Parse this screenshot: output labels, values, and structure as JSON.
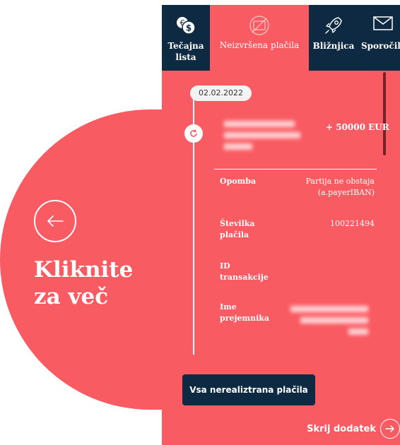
{
  "callout": {
    "text": "Kliknite\nza več",
    "icon": "arrow-left-icon"
  },
  "tabs": [
    {
      "label": "Tečajna\nlista",
      "icon": "currency-exchange-icon",
      "active": false
    },
    {
      "label": "Neizvršena plačila",
      "icon": "no-payment-icon",
      "active": true
    },
    {
      "label": "Bližnjica",
      "icon": "rocket-icon",
      "active": false
    },
    {
      "label": "Sporočila",
      "icon": "envelope-icon",
      "active": false
    }
  ],
  "transaction": {
    "date": "02.02.2022",
    "status_icon": "refresh-icon",
    "amount": "+ 50000 EUR",
    "fields": [
      {
        "label": "Opomba",
        "value": "Partija ne obstaja\n(a.payerIBAN)"
      },
      {
        "label": "Številka\nplačila",
        "value": "100221494"
      },
      {
        "label": "ID\ntransakcije",
        "value": ""
      },
      {
        "label": "Ime\nprejemnika",
        "value": ""
      }
    ]
  },
  "actions": {
    "all_unrealized": "Vsa nerealiztrana plačila",
    "hide_addon": "Skrij dodatek"
  },
  "colors": {
    "brand_red": "#f95b62",
    "navy": "#0e2a43"
  }
}
